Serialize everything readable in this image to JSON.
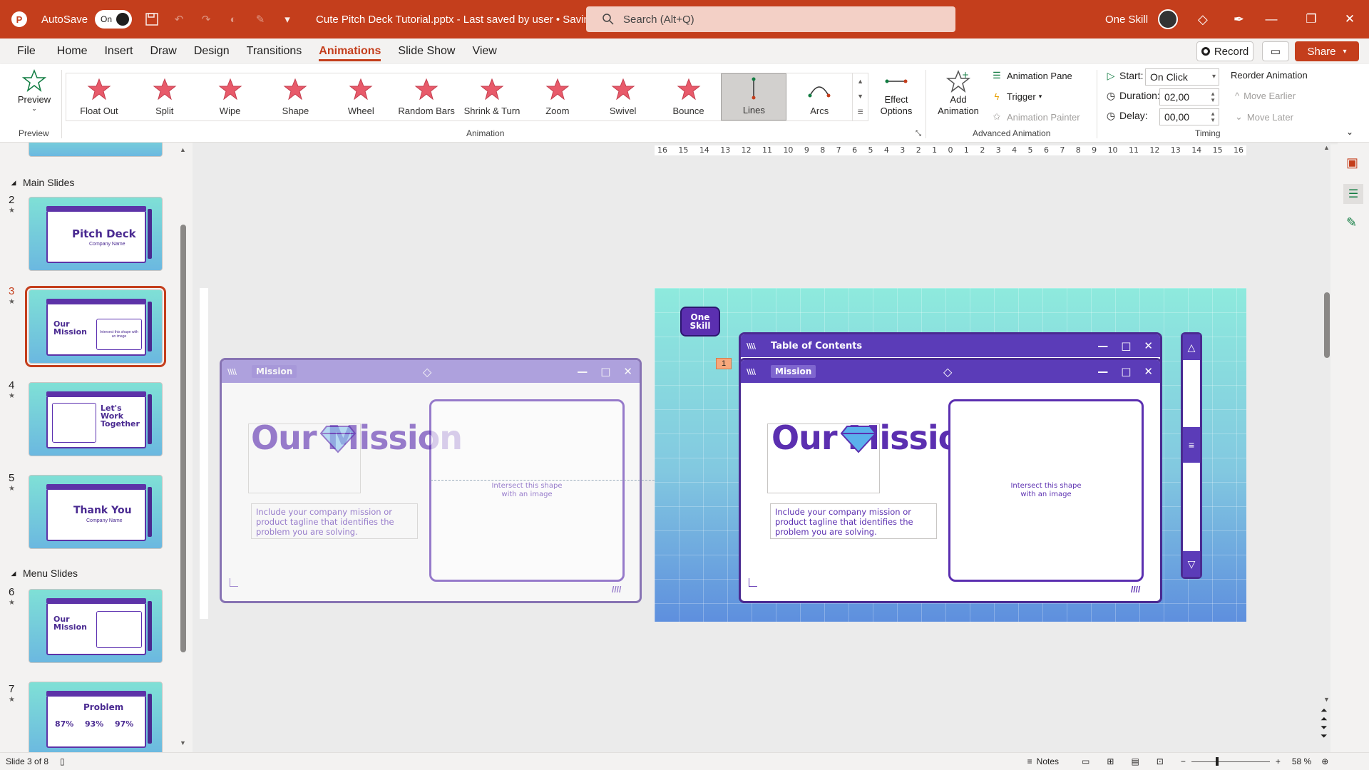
{
  "titlebar": {
    "autosave_label": "AutoSave",
    "autosave_state": "On",
    "doc_title": "Cute Pitch Deck Tutorial.pptx  -  Last saved by user  •  Saving...",
    "search_placeholder": "Search (Alt+Q)",
    "user_name": "One Skill"
  },
  "tabs": [
    "File",
    "Home",
    "Insert",
    "Draw",
    "Design",
    "Transitions",
    "Animations",
    "Slide Show",
    "View"
  ],
  "active_tab": "Animations",
  "actions": {
    "record": "Record",
    "share": "Share"
  },
  "ribbon": {
    "preview_label": "Preview",
    "preview_group": "Preview",
    "animations": [
      "Float Out",
      "Split",
      "Wipe",
      "Shape",
      "Wheel",
      "Random Bars",
      "Shrink & Turn",
      "Zoom",
      "Swivel",
      "Bounce",
      "Lines",
      "Arcs"
    ],
    "selected_animation": "Lines",
    "effect_options": "Effect Options",
    "animation_group": "Animation",
    "add_animation": "Add Animation",
    "animation_pane": "Animation Pane",
    "trigger": "Trigger",
    "animation_painter": "Animation Painter",
    "advanced_group": "Advanced Animation",
    "start_label": "Start:",
    "start_value": "On Click",
    "duration_label": "Duration:",
    "duration_value": "02,00",
    "delay_label": "Delay:",
    "delay_value": "00,00",
    "timing_group": "Timing",
    "reorder_title": "Reorder Animation",
    "move_earlier": "Move Earlier",
    "move_later": "Move Later"
  },
  "thumbs": {
    "sections": [
      "Main Slides",
      "Menu Slides"
    ],
    "slides": [
      {
        "num": "2",
        "title": "Pitch Deck",
        "sub": "Company Name"
      },
      {
        "num": "3",
        "title": "Our Mission",
        "sub": "Intersect this shape with an image"
      },
      {
        "num": "4",
        "title": "Let's Work Together",
        "sub": ""
      },
      {
        "num": "5",
        "title": "Thank You",
        "sub": "Company Name"
      },
      {
        "num": "6",
        "title": "Our Mission",
        "sub": ""
      },
      {
        "num": "7",
        "title": "Problem",
        "sub": "",
        "stats": [
          "87%",
          "93%",
          "97%"
        ]
      }
    ]
  },
  "ruler_ticks": [
    "16",
    "15",
    "14",
    "13",
    "12",
    "11",
    "10",
    "9",
    "8",
    "7",
    "6",
    "5",
    "4",
    "3",
    "2",
    "1",
    "0",
    "1",
    "2",
    "3",
    "4",
    "5",
    "6",
    "7",
    "8",
    "9",
    "10",
    "11",
    "12",
    "13",
    "14",
    "15",
    "16"
  ],
  "slide": {
    "logo_text": "One Skill",
    "anim_marker": "1",
    "toc_title": "Table of Contents",
    "mission_tab": "Mission",
    "mission_heading": "Our Mission",
    "mission_text": "Include your company mission or product tagline that identifies the problem you are solving.",
    "image_placeholder": "Intersect this shape with an image"
  },
  "status": {
    "slide_info": "Slide 3 of 8",
    "notes": "Notes",
    "zoom": "58 %"
  },
  "colors": {
    "accent": "#c43e1c",
    "slide_purple": "#5b2fb0"
  }
}
